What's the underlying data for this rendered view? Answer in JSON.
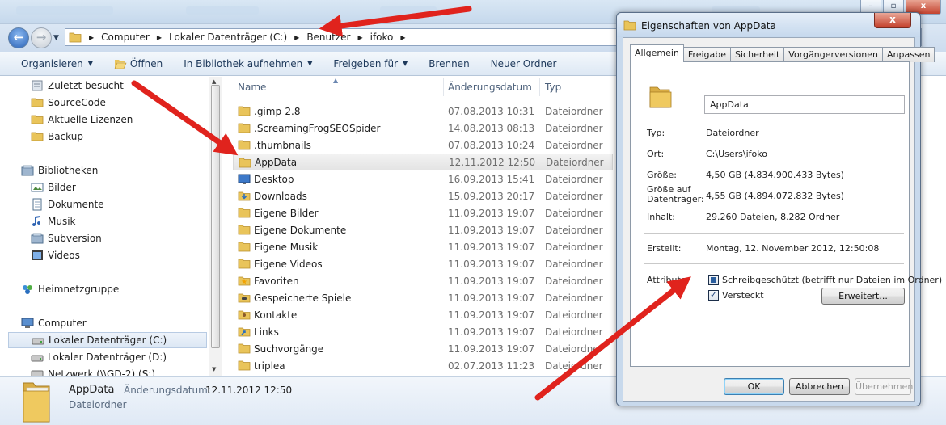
{
  "address": {
    "crumbs": [
      "Computer",
      "Lokaler Datenträger (C:)",
      "Benutzer",
      "ifoko"
    ]
  },
  "toolbar": {
    "organize": "Organisieren",
    "open": "Öffnen",
    "library": "In Bibliothek aufnehmen",
    "share": "Freigeben für",
    "burn": "Brennen",
    "new_folder": "Neuer Ordner"
  },
  "nav": {
    "items": [
      {
        "label": "Zuletzt besucht",
        "icon": "recent-icon"
      },
      {
        "label": "SourceCode",
        "icon": "folder-icon"
      },
      {
        "label": "Aktuelle Lizenzen",
        "icon": "folder-icon"
      },
      {
        "label": "Backup",
        "icon": "folder-icon"
      },
      {
        "label": "Bibliotheken",
        "icon": "library-icon"
      },
      {
        "label": "Bilder",
        "icon": "pictures-icon"
      },
      {
        "label": "Dokumente",
        "icon": "documents-icon"
      },
      {
        "label": "Musik",
        "icon": "music-icon"
      },
      {
        "label": "Subversion",
        "icon": "library-icon"
      },
      {
        "label": "Videos",
        "icon": "videos-icon"
      },
      {
        "label": "Heimnetzgruppe",
        "icon": "homegroup-icon"
      },
      {
        "label": "Computer",
        "icon": "computer-icon"
      },
      {
        "label": "Lokaler Datenträger (C:)",
        "icon": "drive-icon"
      },
      {
        "label": "Lokaler Datenträger (D:)",
        "icon": "drive-icon"
      },
      {
        "label": "Netzwerk (\\\\GD-2) (S:)",
        "icon": "network-drive-icon"
      }
    ]
  },
  "filelist": {
    "headers": {
      "name": "Name",
      "date": "Änderungsdatum",
      "type": "Typ"
    },
    "rows": [
      {
        "name": ".gimp-2.8",
        "date": "07.08.2013 10:31",
        "type": "Dateiordner"
      },
      {
        "name": ".ScreamingFrogSEOSpider",
        "date": "14.08.2013 08:13",
        "type": "Dateiordner"
      },
      {
        "name": ".thumbnails",
        "date": "07.08.2013 10:24",
        "type": "Dateiordner"
      },
      {
        "name": "AppData",
        "date": "12.11.2012 12:50",
        "type": "Dateiordner"
      },
      {
        "name": "Desktop",
        "date": "16.09.2013 15:41",
        "type": "Dateiordner"
      },
      {
        "name": "Downloads",
        "date": "15.09.2013 20:17",
        "type": "Dateiordner"
      },
      {
        "name": "Eigene Bilder",
        "date": "11.09.2013 19:07",
        "type": "Dateiordner"
      },
      {
        "name": "Eigene Dokumente",
        "date": "11.09.2013 19:07",
        "type": "Dateiordner"
      },
      {
        "name": "Eigene Musik",
        "date": "11.09.2013 19:07",
        "type": "Dateiordner"
      },
      {
        "name": "Eigene Videos",
        "date": "11.09.2013 19:07",
        "type": "Dateiordner"
      },
      {
        "name": "Favoriten",
        "date": "11.09.2013 19:07",
        "type": "Dateiordner"
      },
      {
        "name": "Gespeicherte Spiele",
        "date": "11.09.2013 19:07",
        "type": "Dateiordner"
      },
      {
        "name": "Kontakte",
        "date": "11.09.2013 19:07",
        "type": "Dateiordner"
      },
      {
        "name": "Links",
        "date": "11.09.2013 19:07",
        "type": "Dateiordner"
      },
      {
        "name": "Suchvorgänge",
        "date": "11.09.2013 19:07",
        "type": "Dateiordner"
      },
      {
        "name": "triplea",
        "date": "02.07.2013 11:23",
        "type": "Dateiordner"
      }
    ]
  },
  "details": {
    "name": "AppData",
    "date_label": "Änderungsdatum:",
    "date_value": "12.11.2012 12:50",
    "type": "Dateiordner"
  },
  "dialog": {
    "title": "Eigenschaften von AppData",
    "close": "x",
    "tabs": [
      "Allgemein",
      "Freigabe",
      "Sicherheit",
      "Vorgängerversionen",
      "Anpassen"
    ],
    "name_value": "AppData",
    "props": {
      "typ_label": "Typ:",
      "typ_value": "Dateiordner",
      "ort_label": "Ort:",
      "ort_value": "C:\\Users\\ifoko",
      "size_label": "Größe:",
      "size_value": "4,50 GB (4.834.900.433 Bytes)",
      "disk_label_1": "Größe auf",
      "disk_label_2": "Datenträger:",
      "disk_value": "4,55 GB (4.894.072.832 Bytes)",
      "content_label": "Inhalt:",
      "content_value": "29.260 Dateien, 8.282 Ordner",
      "created_label": "Erstellt:",
      "created_value": "Montag, 12. November 2012, 12:50:08",
      "attr_label": "Attribute:",
      "readonly_label": "Schreibgeschützt (betrifft nur Dateien im Ordner)",
      "hidden_label": "Versteckt",
      "advanced_label": "Erweitert..."
    },
    "buttons": {
      "ok": "OK",
      "cancel": "Abbrechen",
      "apply": "Übernehmen"
    }
  },
  "colors": {
    "arrow": "#e0231d",
    "folder": "#e9c45a",
    "accent": "#3c7fb1"
  }
}
